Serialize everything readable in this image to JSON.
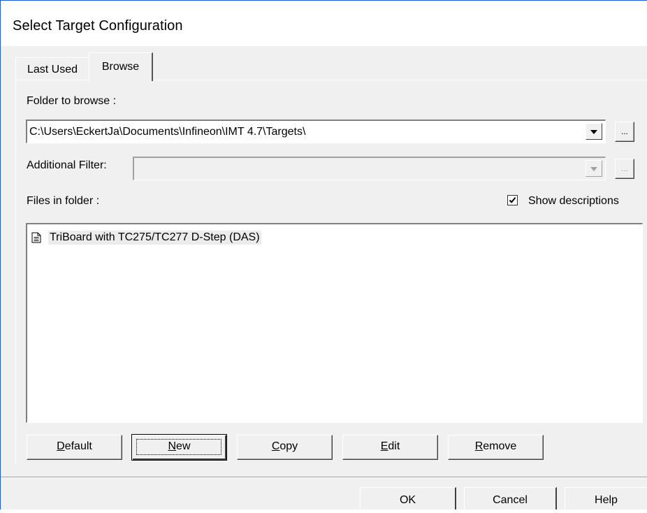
{
  "window": {
    "title": "Select Target Configuration"
  },
  "tabs": [
    {
      "label": "Last Used",
      "active": false
    },
    {
      "label": "Browse",
      "active": true
    }
  ],
  "folder": {
    "label": "Folder to browse :",
    "value": "C:\\Users\\EckertJa\\Documents\\Infineon\\IMT 4.7\\Targets\\",
    "browse_label": "..."
  },
  "filter": {
    "label": "Additional Filter:",
    "value": "",
    "browse_label": "...",
    "enabled": false
  },
  "files": {
    "label": "Files in folder :",
    "show_descriptions": {
      "label": "Show descriptions",
      "checked": true
    },
    "items": [
      {
        "label": "TriBoard with TC275/TC277 D-Step (DAS)",
        "icon": "document-icon"
      }
    ]
  },
  "actions": {
    "default": {
      "mnemonic": "D",
      "rest": "efault"
    },
    "new": {
      "mnemonic": "N",
      "rest": "ew"
    },
    "copy": {
      "mnemonic": "C",
      "rest": "opy"
    },
    "edit": {
      "mnemonic": "E",
      "rest": "dit"
    },
    "remove": {
      "mnemonic": "R",
      "rest": "emove"
    }
  },
  "dialog_buttons": {
    "ok": "OK",
    "cancel": "Cancel",
    "help": "Help"
  },
  "colors": {
    "window_border": "#1e5ad8",
    "face": "#f0f0f0",
    "selection": "#ececec"
  }
}
